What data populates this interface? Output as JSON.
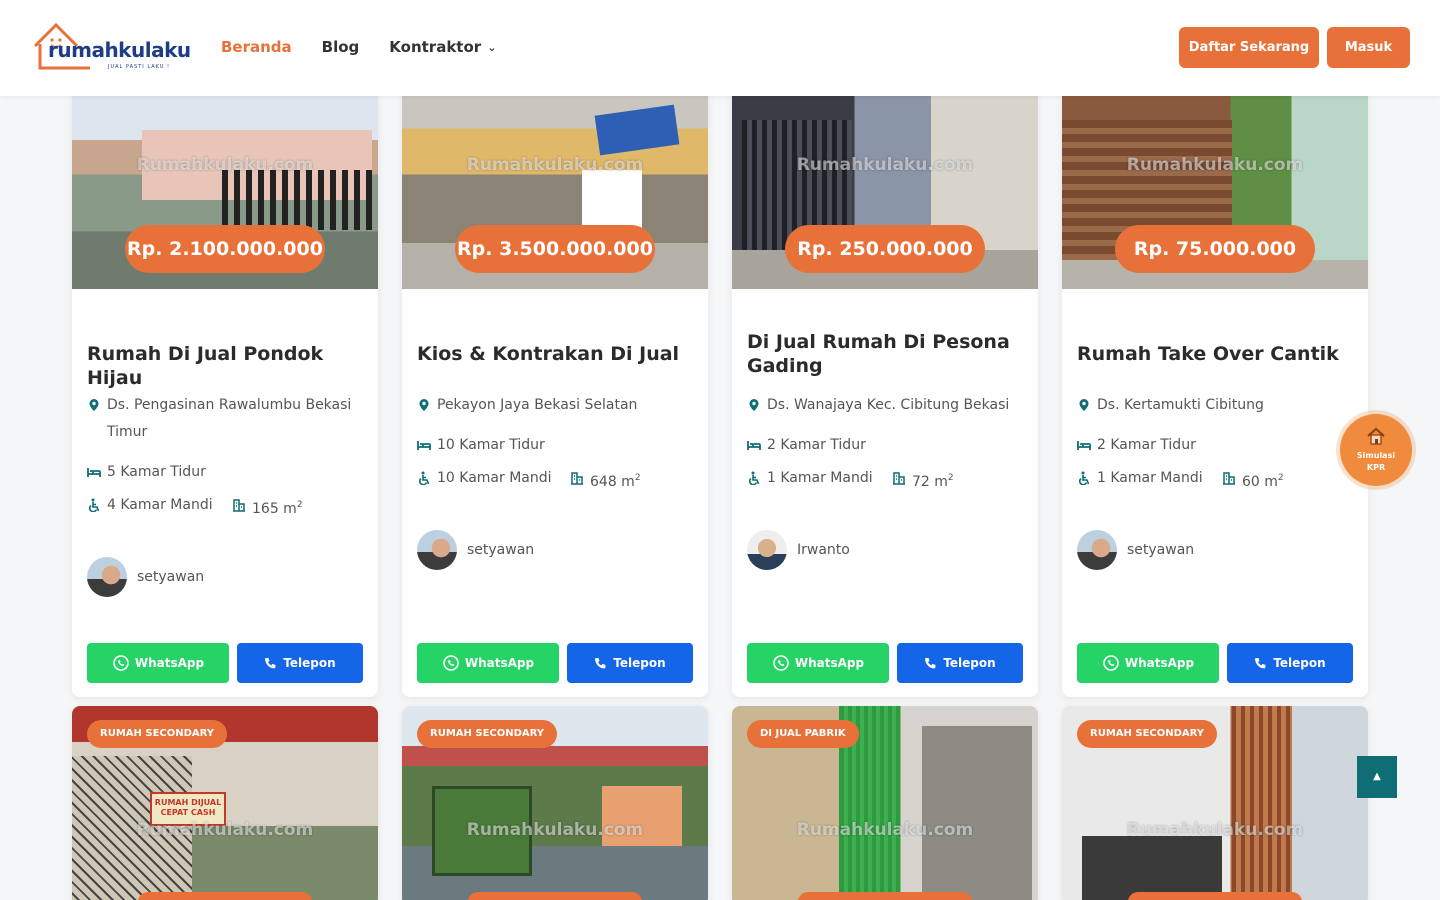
{
  "header": {
    "logo_text": "rumahkulaku",
    "logo_tagline": "JUAL PASTI LAKU !",
    "nav": [
      {
        "label": "Beranda"
      },
      {
        "label": "Blog"
      },
      {
        "label": "Kontraktor"
      }
    ],
    "register_label": "Daftar Sekarang",
    "login_label": "Masuk"
  },
  "watermark": "Rumahkulaku.com",
  "listings": [
    {
      "price": "Rp. 2.100.000.000",
      "title": "Rumah Di Jual Pondok Hijau",
      "location": "Ds. Pengasinan Rawalumbu Bekasi Timur",
      "bedrooms": "5 Kamar Tidur",
      "bathrooms": "4 Kamar Mandi",
      "area": "165 m",
      "agent": "setyawan",
      "whatsapp_label": "WhatsApp",
      "phone_label": "Telepon"
    },
    {
      "price": "Rp. 3.500.000.000",
      "title": "Kios & Kontrakan Di Jual",
      "location": "Pekayon Jaya Bekasi Selatan",
      "bedrooms": "10 Kamar Tidur",
      "bathrooms": "10 Kamar Mandi",
      "area": "648 m",
      "agent": "setyawan",
      "whatsapp_label": "WhatsApp",
      "phone_label": "Telepon"
    },
    {
      "price": "Rp. 250.000.000",
      "title": "Di Jual Rumah Di Pesona Gading",
      "location": "Ds. Wanajaya Kec. Cibitung Bekasi",
      "bedrooms": "2 Kamar Tidur",
      "bathrooms": "1 Kamar Mandi",
      "area": "72 m",
      "agent": "Irwanto",
      "whatsapp_label": "WhatsApp",
      "phone_label": "Telepon"
    },
    {
      "price": "Rp. 75.000.000",
      "title": "Rumah Take Over Cantik",
      "location": "Ds. Kertamukti Cibitung",
      "bedrooms": "2 Kamar Tidur",
      "bathrooms": "1 Kamar Mandi",
      "area": "60 m",
      "agent": "setyawan",
      "whatsapp_label": "WhatsApp",
      "phone_label": "Telepon"
    }
  ],
  "listings_row2": [
    {
      "badge": "RUMAH SECONDARY"
    },
    {
      "badge": "RUMAH SECONDARY"
    },
    {
      "badge": "DI JUAL PABRIK"
    },
    {
      "badge": "RUMAH SECONDARY"
    }
  ],
  "photo_sign": {
    "text": "RUMAH DIJUAL CEPAT CASH"
  },
  "kpr": {
    "line1": "Simulasi",
    "line2": "KPR"
  },
  "sup_2": "2",
  "colors": {
    "accent": "#e8713a",
    "whatsapp": "#25d366",
    "phone": "#1565e8",
    "brand": "#1f3c88",
    "to_top": "#0f6d75"
  }
}
